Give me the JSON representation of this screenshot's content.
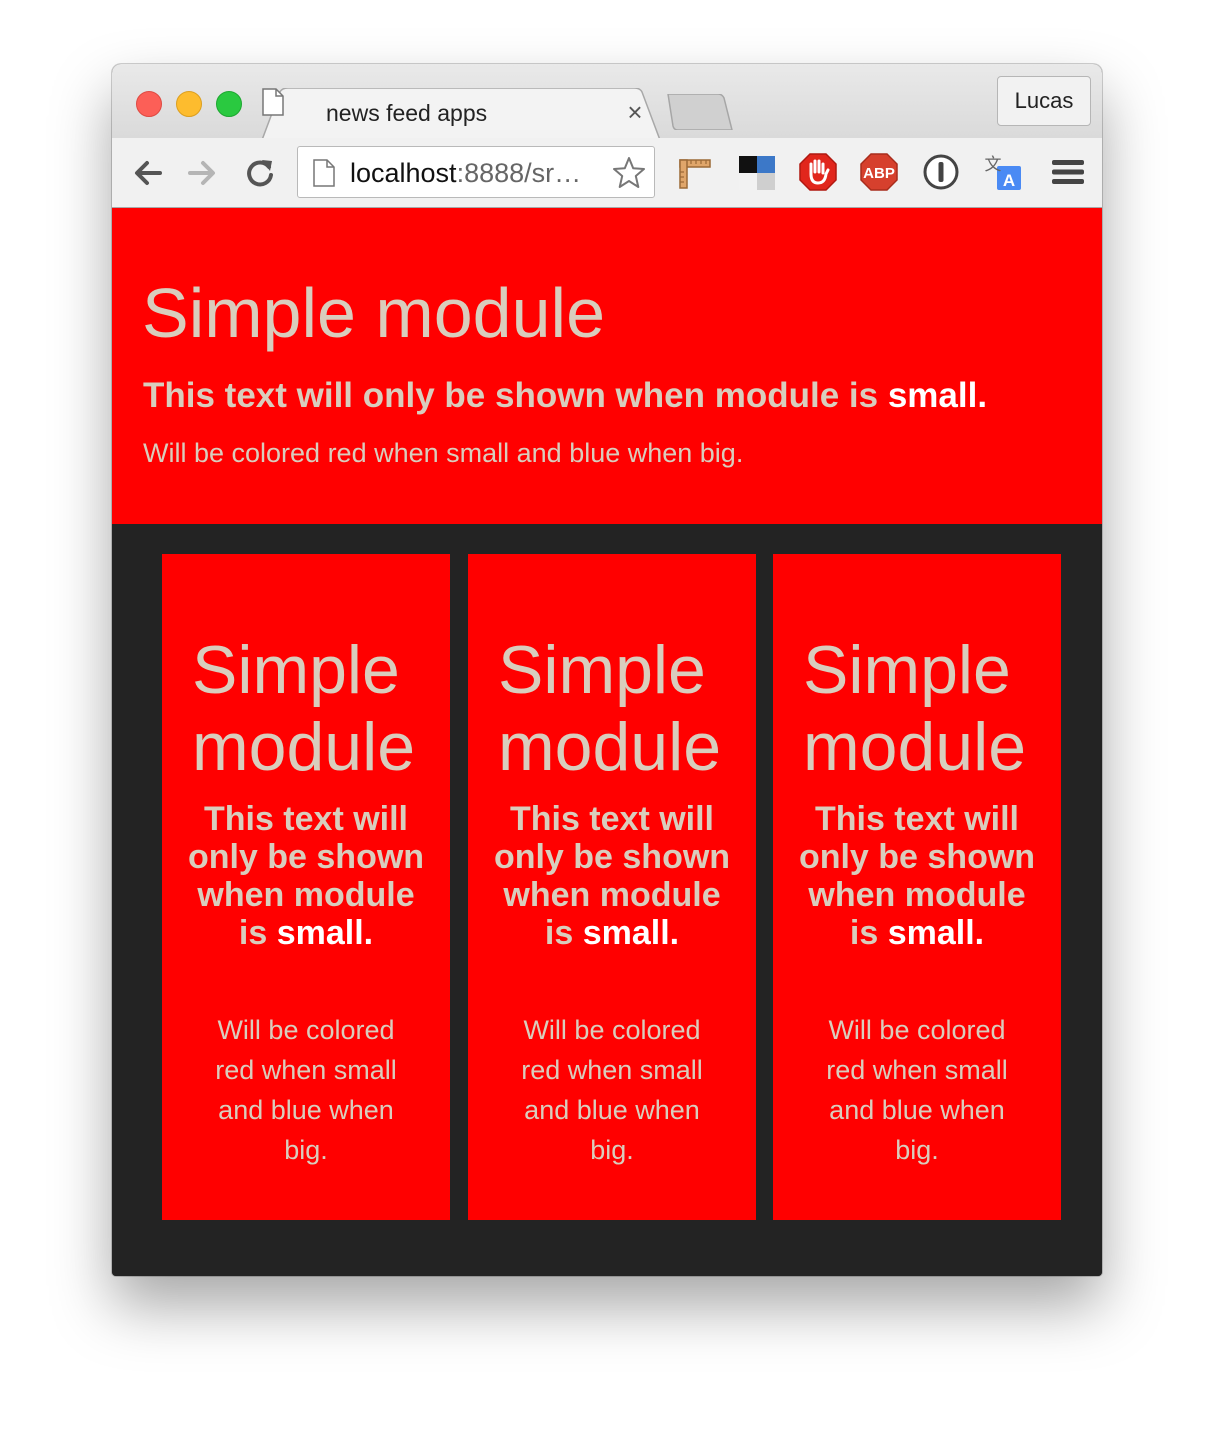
{
  "browser": {
    "tab_title": "news feed apps",
    "tab_close": "×",
    "profile_name": "Lucas",
    "url_host": "localhost",
    "url_rest": ":8888/sr…",
    "extensions": [
      "ruler-extension",
      "tile-extension",
      "stop-extension",
      "adblock-plus-extension",
      "onepassword-extension",
      "translate-extension"
    ],
    "adblock_label": "ABP"
  },
  "hero": {
    "title": "Simple module",
    "subtitle_text": "This text will only be shown when module is ",
    "subtitle_strong": "small",
    "subtitle_end": ".",
    "note": "Will be colored red when small and blue when big."
  },
  "cards": [
    {
      "title": "Simple module",
      "subtitle_text": "This text will only be shown when module is ",
      "subtitle_strong": "small",
      "subtitle_end": ".",
      "note": "Will be colored red when small and blue when big."
    },
    {
      "title": "Simple module",
      "subtitle_text": "This text will only be shown when module is ",
      "subtitle_strong": "small",
      "subtitle_end": ".",
      "note": "Will be colored red when small and blue when big."
    },
    {
      "title": "Simple module",
      "subtitle_text": "This text will only be shown when module is ",
      "subtitle_strong": "small",
      "subtitle_end": ".",
      "note": "Will be colored red when small and blue when big."
    }
  ],
  "colors": {
    "module_background": "#ff0000",
    "page_background": "#232323",
    "text": "#d9cdbd",
    "strong_text": "#ffffff"
  }
}
